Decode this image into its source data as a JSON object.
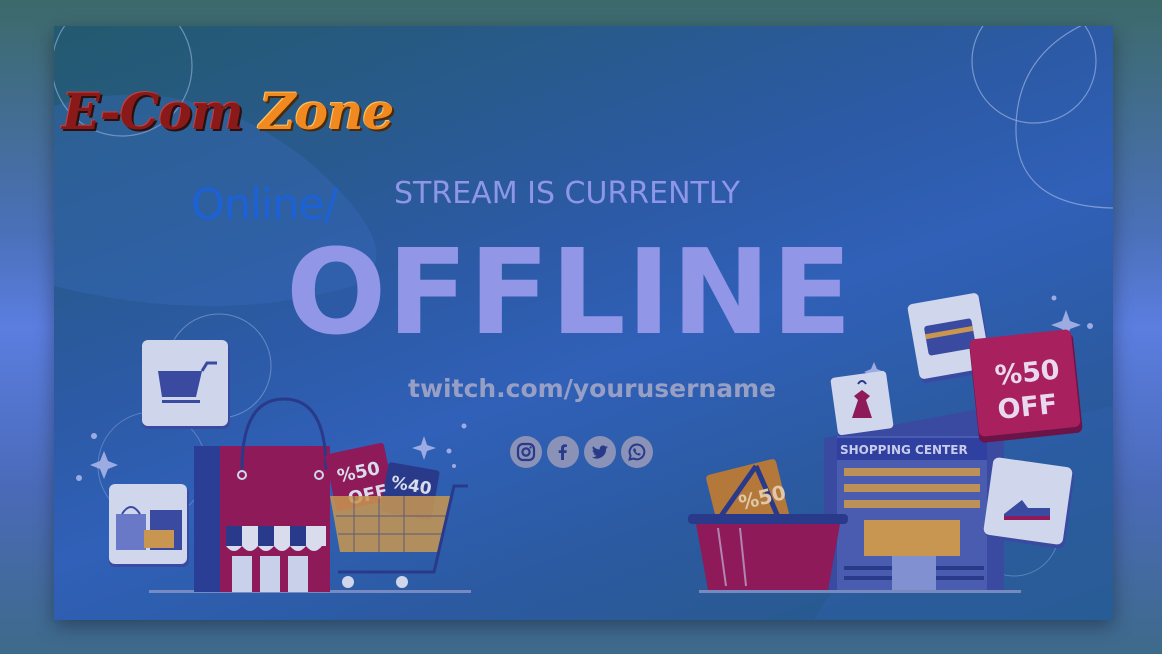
{
  "brand": {
    "part1": "E-Com",
    "part2": "Zone"
  },
  "status": {
    "online_label": "Online/",
    "prefix": "STREAM IS CURRENTLY",
    "state": "OFFLINE",
    "url": "twitch.com/yourusername"
  },
  "badges": {
    "left_tag_1": "%50",
    "left_tag_2": "OFF",
    "left_tag_3": "%40",
    "right_tag_number": "%50",
    "right_tag_off": "OFF",
    "basket_tag": "%50",
    "shop_sign": "SHOPPING CENTER"
  },
  "socials": [
    {
      "icon": "instagram-icon"
    },
    {
      "icon": "facebook-icon"
    },
    {
      "icon": "twitter-icon"
    },
    {
      "icon": "whatsapp-icon"
    }
  ],
  "colors": {
    "offline_text": "#9196e6",
    "online_text": "#1c62d6",
    "brand_red": "#8a1a1a",
    "brand_orange": "#f08a20",
    "accent_magenta": "#8e1a5a"
  }
}
